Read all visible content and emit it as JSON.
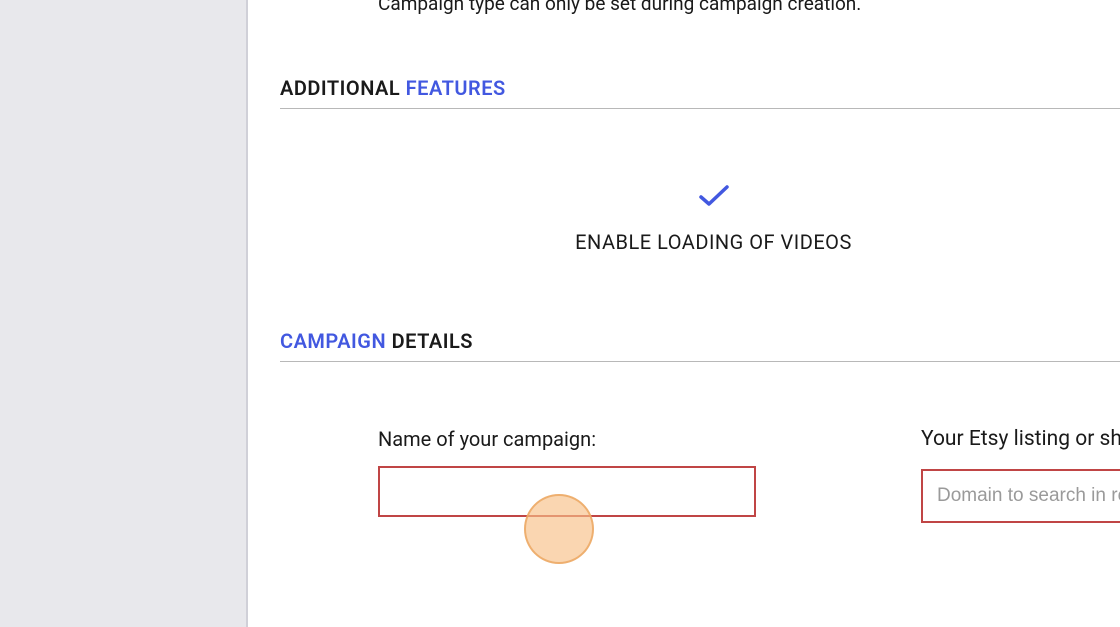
{
  "top_hint": "Campaign type can only be set during campaign creation.",
  "sections": {
    "additional_features": {
      "heading_part1": "ADDITIONAL ",
      "heading_accent": "FEATURES",
      "feature_video_label": "ENABLE LOADING OF VIDEOS"
    },
    "campaign_details": {
      "heading_accent": "CAMPAIGN",
      "heading_part2": " DETAILS",
      "campaign_name_label": "Name of your campaign:",
      "campaign_name_value": "",
      "listing_label": "Your Etsy listing or shop",
      "listing_placeholder": "Domain to search in re",
      "listing_value": ""
    }
  }
}
